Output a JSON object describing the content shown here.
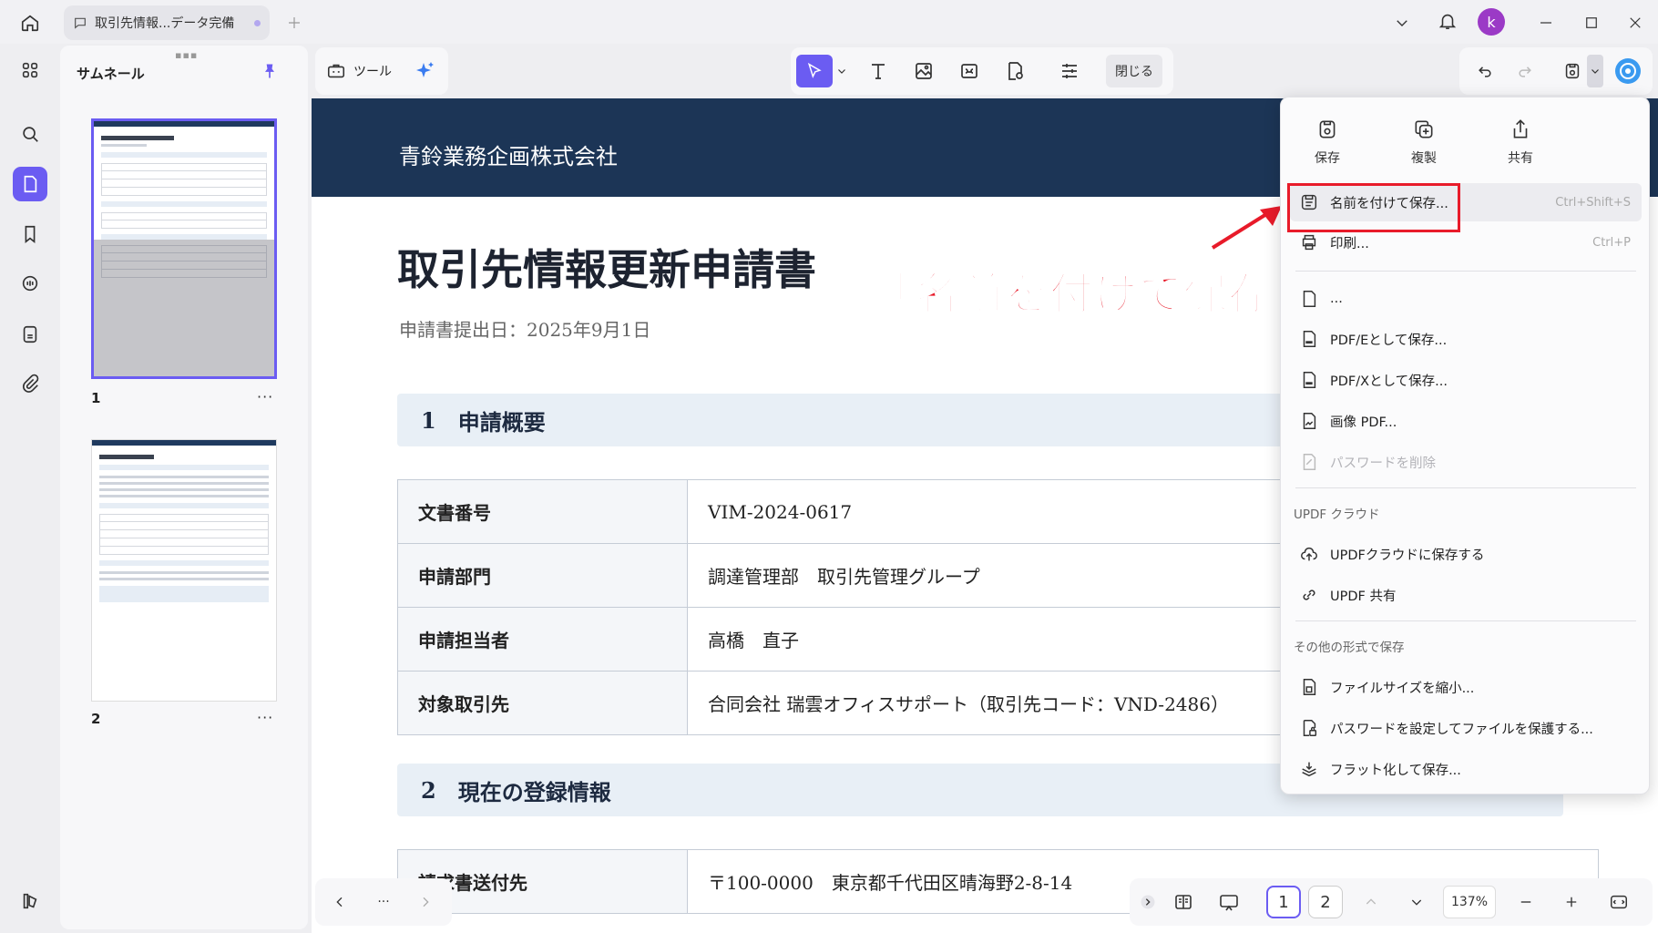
{
  "tab": {
    "title": "取引先情報...データ完備"
  },
  "user": {
    "initial": "k"
  },
  "thumbnails": {
    "header": "サムネール",
    "pages": [
      {
        "number": "1",
        "more": "···"
      },
      {
        "number": "2",
        "more": "···"
      }
    ]
  },
  "toolbar": {
    "tools_label": "ツール",
    "close_label": "閉じる"
  },
  "document": {
    "company": "青鈴業務企画株式会社",
    "title": "取引先情報更新申請書",
    "date": "申請書提出日：2025年9月1日",
    "section1": {
      "num": "1",
      "title": "申請概要"
    },
    "rows": [
      {
        "key": "文書番号",
        "value": "VIM-2024-0617"
      },
      {
        "key": "申請部門",
        "value": "調達管理部　取引先管理グループ"
      },
      {
        "key": "申請担当者",
        "value": "高橋　直子"
      },
      {
        "key": "対象取引先",
        "value": "合同会社 瑞雲オフィスサポート（取引先コード：VND-2486）"
      }
    ],
    "section2": {
      "num": "2",
      "title": "現在の登録情報"
    },
    "row2": {
      "key": "請求書送付先",
      "value": "〒100-0000　東京都千代田区晴海野2-8-14"
    }
  },
  "annotation": "「名前を付けて保存」を選択",
  "menu": {
    "quick": [
      {
        "label": "保存"
      },
      {
        "label": "複製"
      },
      {
        "label": "共有"
      }
    ],
    "save_as": {
      "label": "名前を付けて保存...",
      "shortcut": "Ctrl+Shift+S"
    },
    "print": {
      "label": "印刷...",
      "shortcut": "Ctrl+P"
    },
    "hidden_item": "...",
    "pdfe": "PDF/Eとして保存...",
    "pdfx": "PDF/Xとして保存...",
    "image_pdf": "画像 PDF...",
    "remove_password": "パスワードを削除",
    "cloud_section": "UPDF クラウド",
    "cloud_save": "UPDFクラウドに保存する",
    "updf_share": "UPDF 共有",
    "other_section": "その他の形式で保存",
    "reduce": "ファイルサイズを縮小...",
    "protect": "パスワードを設定してファイルを保護する...",
    "flatten": "フラット化して保存..."
  },
  "bottom": {
    "pages": [
      "1",
      "2"
    ],
    "zoom": "137%",
    "more": "···"
  },
  "colors": {
    "accent": "#6b5cf2",
    "banner": "#1c3556",
    "annotation": "#e81b2a"
  }
}
